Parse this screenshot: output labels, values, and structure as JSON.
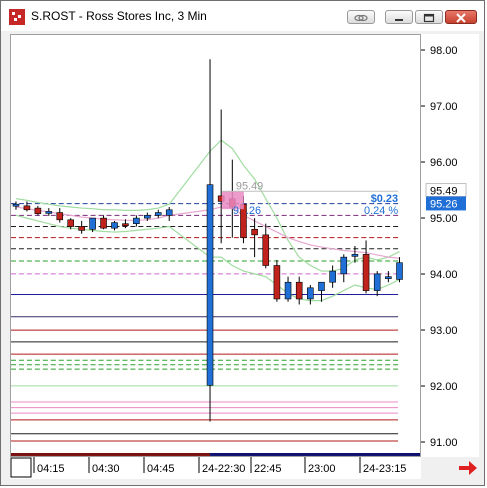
{
  "window": {
    "title": "S.ROST - Ross Stores Inc, 3 Min",
    "icon": "chart-app-icon",
    "buttons": [
      "link-icon",
      "minimize-icon",
      "maximize-icon",
      "close-icon"
    ]
  },
  "colors": {
    "up": "#1f6fd6",
    "down": "#c0231b",
    "price_line": "#1f6fd6",
    "band": "#9fdc9f",
    "avg": "#e7a6d0",
    "highlight": "#e98ac2"
  },
  "annotations": {
    "highlight_value": "95.49",
    "change_value": "$0.23",
    "change_pct": "0.24 %",
    "current_value": "95.26",
    "current_label_partial": "9",
    "current_value_partial": ".26"
  },
  "yaxis": {
    "ticks": [
      "98.00",
      "97.00",
      "96.00",
      "95.00",
      "94.00",
      "93.00",
      "92.00",
      "91.00"
    ],
    "current_label": "95.26",
    "marker_label": "95.49"
  },
  "xaxis": {
    "labels": [
      "04:15",
      "04:30",
      "04:45",
      "24-22:30",
      "22:45",
      "23:00",
      "24-23:15"
    ]
  },
  "levels": [
    {
      "price": 95.26,
      "color": "#1f3f9f",
      "style": "dash"
    },
    {
      "price": 95.05,
      "color": "#7a2a7a",
      "style": "dash"
    },
    {
      "price": 94.85,
      "color": "#1f1f1f",
      "style": "dash"
    },
    {
      "price": 94.65,
      "color": "#b01818",
      "style": "dash"
    },
    {
      "price": 94.45,
      "color": "#1f1f1f",
      "style": "dash"
    },
    {
      "price": 94.23,
      "color": "#2aa02a",
      "style": "dash"
    },
    {
      "price": 94.0,
      "color": "#cc66cc",
      "style": "dash"
    },
    {
      "price": 93.63,
      "color": "#1f1fa0",
      "style": "solid"
    },
    {
      "price": 93.23,
      "color": "#3a2a6a",
      "style": "solid"
    },
    {
      "price": 92.99,
      "color": "#b01818",
      "style": "solid"
    },
    {
      "price": 92.78,
      "color": "#1f1f1f",
      "style": "solid"
    },
    {
      "price": 92.56,
      "color": "#b01818",
      "style": "solid"
    },
    {
      "price": 92.45,
      "color": "#2aa02a",
      "style": "dash"
    },
    {
      "price": 92.37,
      "color": "#2aa02a",
      "style": "dash"
    },
    {
      "price": 92.29,
      "color": "#2aa02a",
      "style": "dash"
    },
    {
      "price": 91.99,
      "color": "#9fdc9f",
      "style": "solid"
    },
    {
      "price": 91.7,
      "color": "#e98ac2",
      "style": "solid"
    },
    {
      "price": 91.6,
      "color": "#e98ac2",
      "style": "solid"
    },
    {
      "price": 91.5,
      "color": "#e98ac2",
      "style": "solid"
    },
    {
      "price": 91.38,
      "color": "#b01818",
      "style": "solid"
    },
    {
      "price": 91.13,
      "color": "#1f1f1f",
      "style": "solid"
    },
    {
      "price": 91.0,
      "color": "#b01818",
      "style": "solid"
    }
  ],
  "candles": [
    {
      "o": 95.22,
      "h": 95.3,
      "l": 95.15,
      "c": 95.25
    },
    {
      "o": 95.22,
      "h": 95.3,
      "l": 95.12,
      "c": 95.15
    },
    {
      "o": 95.18,
      "h": 95.22,
      "l": 95.05,
      "c": 95.08
    },
    {
      "o": 95.1,
      "h": 95.18,
      "l": 95.04,
      "c": 95.12
    },
    {
      "o": 95.1,
      "h": 95.18,
      "l": 94.92,
      "c": 94.97
    },
    {
      "o": 94.97,
      "h": 95.0,
      "l": 94.8,
      "c": 94.85
    },
    {
      "o": 94.85,
      "h": 94.95,
      "l": 94.72,
      "c": 94.78
    },
    {
      "o": 94.8,
      "h": 95.0,
      "l": 94.75,
      "c": 95.0
    },
    {
      "o": 95.0,
      "h": 95.05,
      "l": 94.8,
      "c": 94.82
    },
    {
      "o": 94.82,
      "h": 94.95,
      "l": 94.78,
      "c": 94.92
    },
    {
      "o": 94.9,
      "h": 94.98,
      "l": 94.82,
      "c": 94.88
    },
    {
      "o": 94.9,
      "h": 95.05,
      "l": 94.85,
      "c": 95.0
    },
    {
      "o": 95.0,
      "h": 95.1,
      "l": 94.95,
      "c": 95.05
    },
    {
      "o": 95.05,
      "h": 95.15,
      "l": 95.0,
      "c": 95.1
    },
    {
      "o": 95.05,
      "h": 95.2,
      "l": 94.95,
      "c": 95.15
    },
    {
      "o": 92.0,
      "h": 97.85,
      "l": 91.35,
      "c": 95.6
    },
    {
      "o": 95.4,
      "h": 96.95,
      "l": 94.55,
      "c": 95.3
    },
    {
      "o": 95.35,
      "h": 96.05,
      "l": 94.65,
      "c": 95.2
    },
    {
      "o": 95.25,
      "h": 95.4,
      "l": 94.55,
      "c": 94.65
    },
    {
      "o": 94.8,
      "h": 95.0,
      "l": 94.3,
      "c": 94.7
    },
    {
      "o": 94.7,
      "h": 94.9,
      "l": 94.1,
      "c": 94.15
    },
    {
      "o": 94.15,
      "h": 94.25,
      "l": 93.5,
      "c": 93.55
    },
    {
      "o": 93.55,
      "h": 93.95,
      "l": 93.5,
      "c": 93.85
    },
    {
      "o": 93.85,
      "h": 93.95,
      "l": 93.45,
      "c": 93.55
    },
    {
      "o": 93.55,
      "h": 93.8,
      "l": 93.45,
      "c": 93.75
    },
    {
      "o": 93.7,
      "h": 93.85,
      "l": 93.5,
      "c": 93.85
    },
    {
      "o": 93.85,
      "h": 94.15,
      "l": 93.75,
      "c": 94.05
    },
    {
      "o": 94.0,
      "h": 94.35,
      "l": 93.85,
      "c": 94.3
    },
    {
      "o": 94.35,
      "h": 94.5,
      "l": 94.2,
      "c": 94.35
    },
    {
      "o": 94.35,
      "h": 94.6,
      "l": 93.65,
      "c": 93.7
    },
    {
      "o": 93.7,
      "h": 94.05,
      "l": 93.6,
      "c": 94.0
    },
    {
      "o": 93.95,
      "h": 94.05,
      "l": 93.85,
      "c": 93.95
    },
    {
      "o": 93.9,
      "h": 94.3,
      "l": 93.85,
      "c": 94.2
    }
  ],
  "band_upper": [
    95.35,
    95.32,
    95.28,
    95.25,
    95.22,
    95.2,
    95.18,
    95.17,
    95.15,
    95.15,
    95.14,
    95.14,
    95.15,
    95.18,
    95.25,
    96.2,
    96.4,
    96.25,
    95.95,
    95.7,
    95.35,
    95.0,
    94.6,
    94.3,
    94.15,
    94.05,
    94.05,
    94.1,
    94.25,
    94.3,
    94.25,
    94.3,
    94.4
  ],
  "band_lower": [
    95.05,
    95.0,
    94.95,
    94.9,
    94.85,
    94.82,
    94.8,
    94.78,
    94.76,
    94.75,
    94.76,
    94.78,
    94.8,
    94.82,
    94.85,
    94.3,
    94.3,
    94.15,
    94.05,
    94.0,
    93.95,
    93.8,
    93.65,
    93.55,
    93.52,
    93.52,
    93.6,
    93.7,
    93.8,
    93.75,
    93.72,
    93.8,
    93.9
  ],
  "avg_line": [
    95.2,
    95.17,
    95.14,
    95.11,
    95.08,
    95.05,
    95.02,
    95.0,
    94.98,
    94.97,
    94.96,
    94.96,
    94.97,
    95.0,
    95.05,
    95.15,
    95.2,
    95.18,
    95.05,
    94.95,
    94.85,
    94.75,
    94.65,
    94.58,
    94.52,
    94.48,
    94.45,
    94.42,
    94.4,
    94.38,
    94.34,
    94.3,
    94.28
  ]
}
